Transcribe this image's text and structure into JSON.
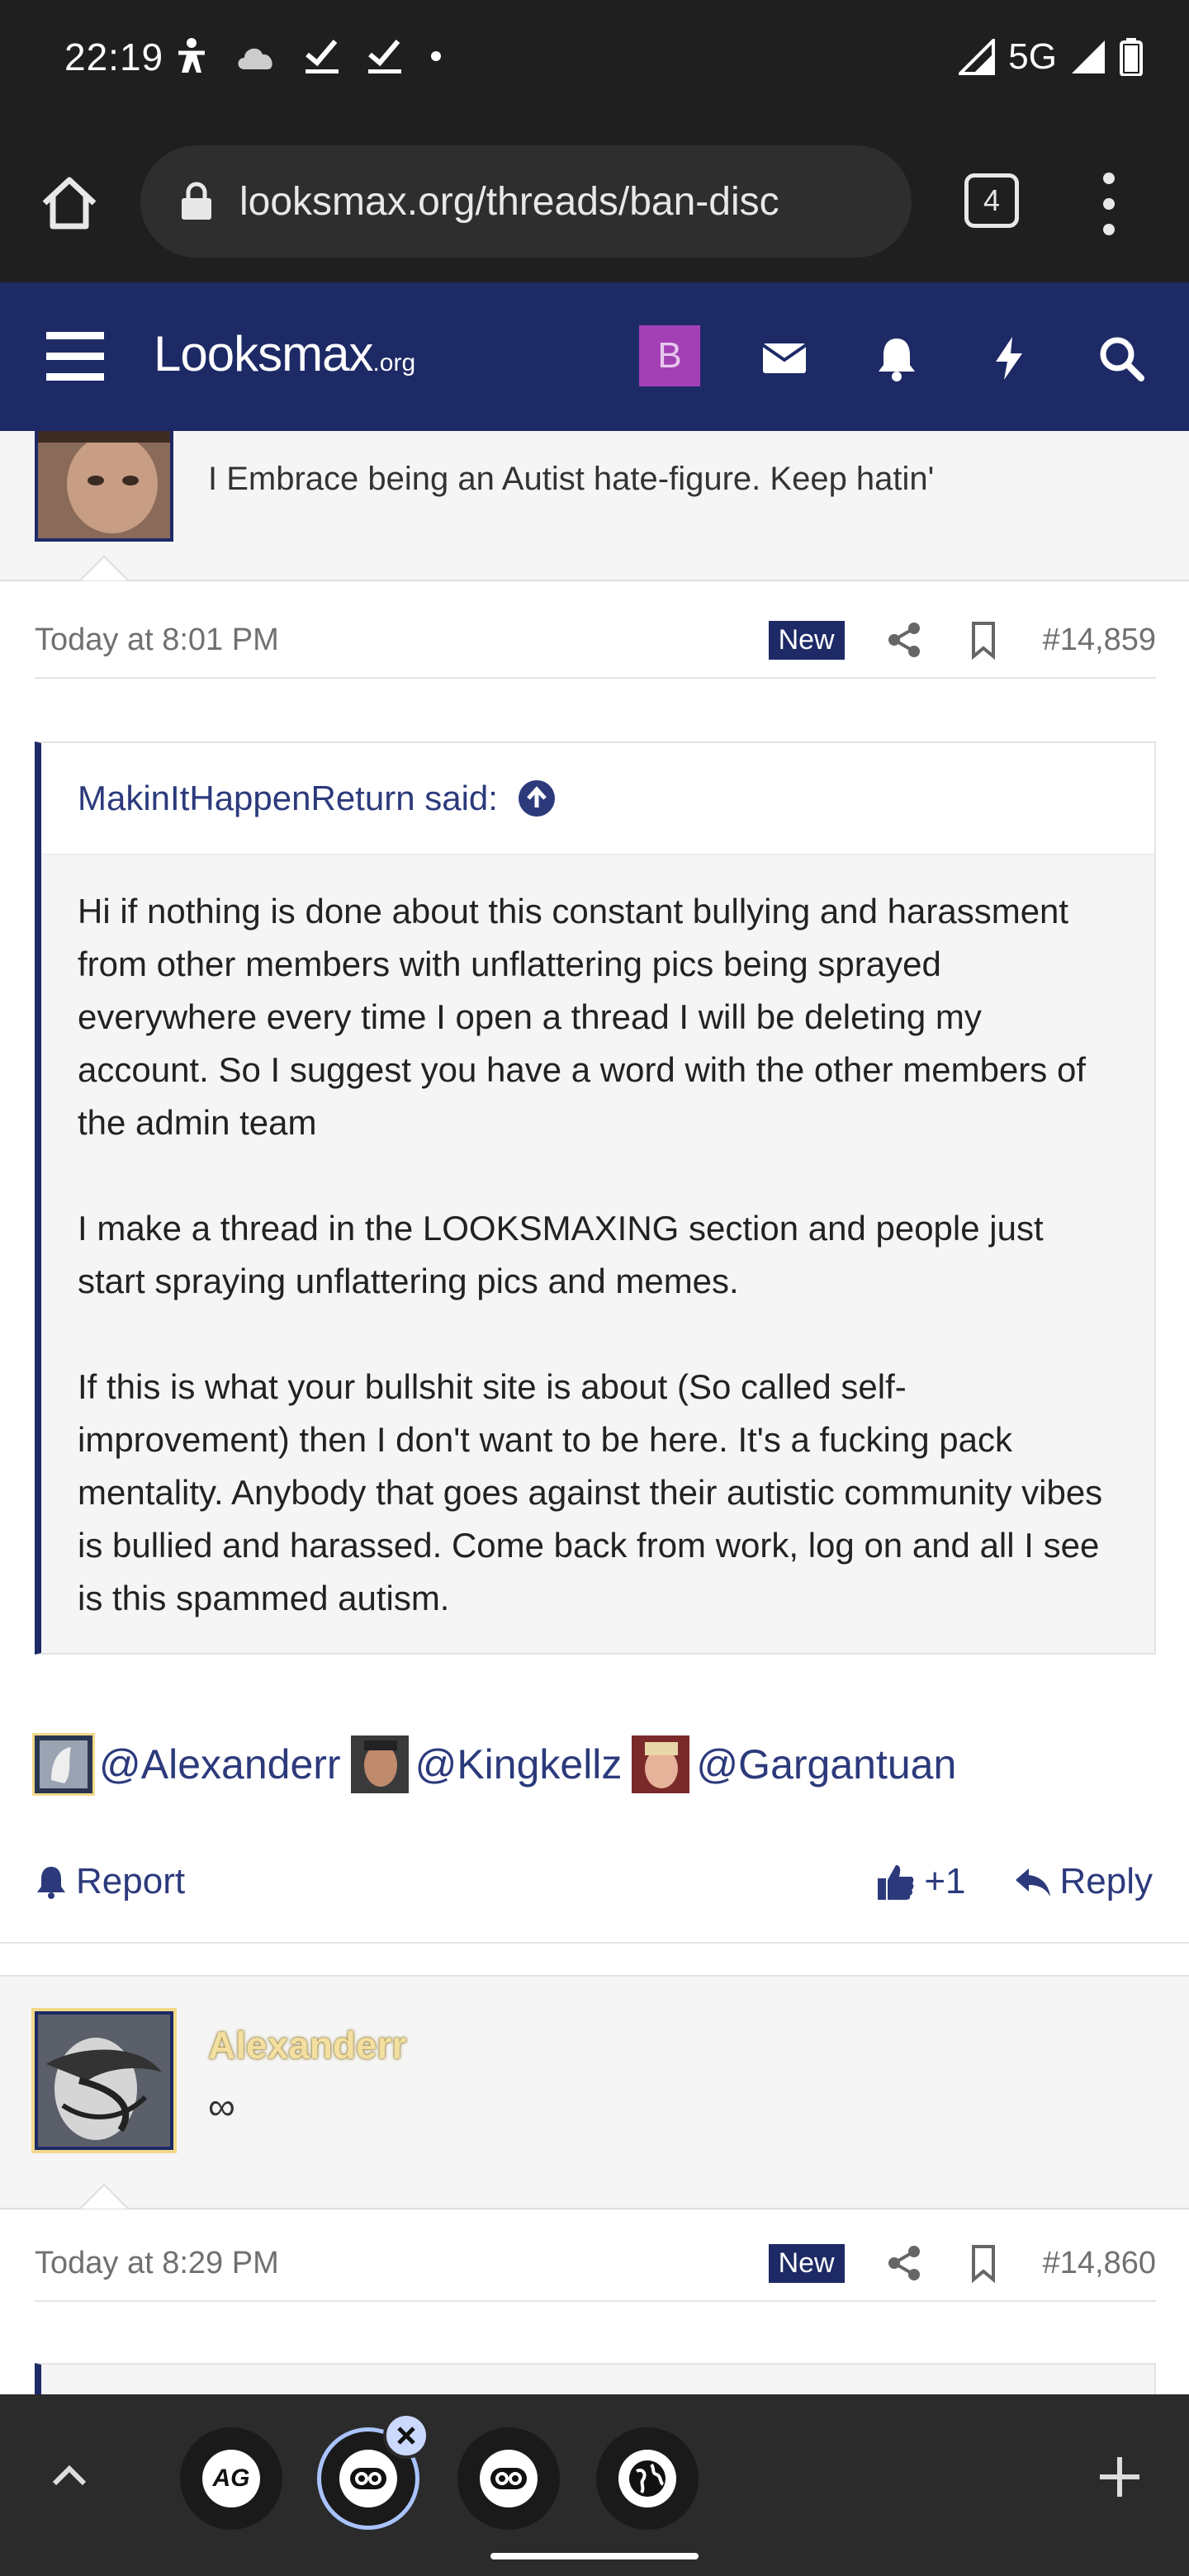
{
  "status_bar": {
    "time": "22:19",
    "network": "5G",
    "icons": [
      "accessibility-icon",
      "cloud-icon",
      "check-icon",
      "check-icon",
      "dot-icon",
      "signal-icon",
      "signal-icon",
      "battery-icon"
    ]
  },
  "browser": {
    "url": "looksmax.org/threads/ban-disc",
    "tab_count": "4"
  },
  "site_header": {
    "logo_main": "Looksmax",
    "logo_suffix": ".org",
    "badge_letter": "B",
    "colors": {
      "header_bg": "#1d2a66",
      "badge_bg": "#a440b6"
    }
  },
  "posts": {
    "prev_user_title": "I Embrace being an Autist hate-figure. Keep hatin'",
    "post1": {
      "date": "Today at 8:01 PM",
      "new_label": "New",
      "number": "#14,859",
      "quote_author": "MakinItHappenReturn said:",
      "quote_p1": "Hi if nothing is done about this constant bullying and harassment from other members with unflattering pics being sprayed everywhere every time I open a thread I will be deleting my account. So I suggest you have a word with the other members of the admin team",
      "quote_p2": "I make a thread in the LOOKSMAXING section and people just start spraying unflattering pics and memes.",
      "quote_p3": "If this is what your bullshit site is about (So called self-improvement) then I don't want to be here. It's a fucking pack mentality. Anybody that goes against their autistic community vibes is bullied and harassed. Come back from work, log on and all I see is this spammed autism.",
      "mentions": [
        "@Alexanderr",
        "@Kingkellz",
        "@Gargantuan"
      ],
      "report_label": "Report",
      "like_label": "+1",
      "reply_label": "Reply"
    },
    "next_user": {
      "name": "Alexanderr",
      "title": "∞"
    },
    "post2": {
      "date": "Today at 8:29 PM",
      "new_label": "New",
      "number": "#14,860"
    }
  },
  "bottom_bar": {
    "bubbles": [
      "ag-icon",
      "looksmax-icon",
      "looksmax-icon",
      "globe-icon"
    ]
  }
}
